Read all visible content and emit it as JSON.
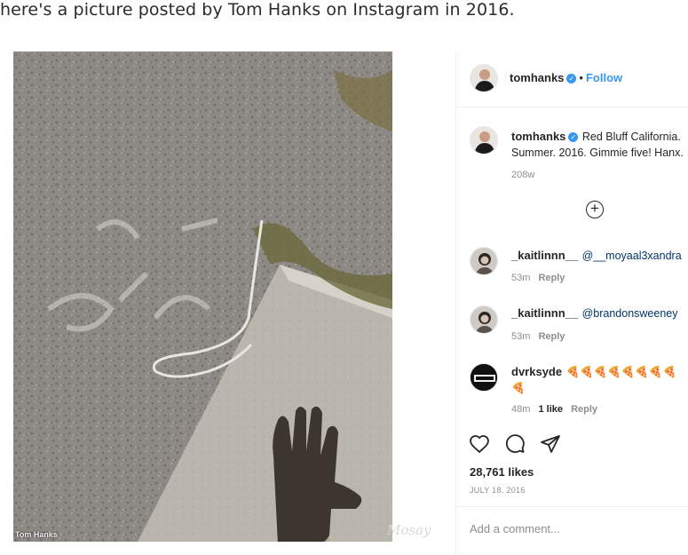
{
  "caption": "here's a picture posted by Tom Hanks on Instagram in 2016.",
  "photo": {
    "credit": "Tom Hanks",
    "watermark": "Mosay"
  },
  "post": {
    "username": "tomhanks",
    "follow_label": "Follow",
    "separator": "•",
    "verified_glyph": "✓",
    "description_line1": "Red Bluff California.",
    "description_line2": "Summer. 2016. Gimmie five! Hanx.",
    "description_age": "208w",
    "load_more_icon": "plus-circle-icon",
    "comments": [
      {
        "username": "_kaitlinnn__",
        "mention": "@__moyaal3xandra",
        "age": "53m",
        "reply": "Reply"
      },
      {
        "username": "_kaitlinnn__",
        "mention": "@brandonsweeney",
        "age": "53m",
        "reply": "Reply"
      },
      {
        "username": "dvrksyde",
        "emoji": "🍕🍕🍕🍕🍕🍕🍕🍕🍕",
        "age": "48m",
        "likes": "1 like",
        "reply": "Reply"
      }
    ],
    "likes": "28,761 likes",
    "date": "JULY 18, 2016",
    "add_comment_placeholder": "Add a comment..."
  },
  "colors": {
    "link_blue": "#3897f0",
    "mention_blue": "#003569",
    "meta_gray": "#8e8e8e"
  }
}
